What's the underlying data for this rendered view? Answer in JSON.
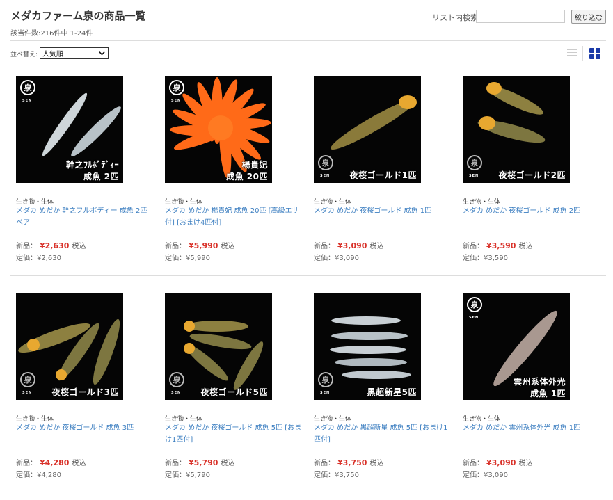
{
  "header": {
    "title": "メダカファーム泉の商品一覧",
    "result_count": "該当件数:216件中 1-24件",
    "search_label": "リスト内検索:",
    "search_value": "",
    "filter_button": "絞り込む"
  },
  "sort": {
    "label": "並べ替え:",
    "selected": "人気順"
  },
  "view_toggle": {
    "active": "grid"
  },
  "brand": {
    "logo_char": "泉",
    "logo_text": "SEN"
  },
  "labels": {
    "new_price": "新品：",
    "tax": "税込",
    "list_price": "定価："
  },
  "colors": {
    "link": "#3d7fc1",
    "price": "#d9322a",
    "grid_icon": "#1a3aa8"
  },
  "products": [
    {
      "category": "生き物・生体",
      "name": "メダカ めだか 幹之フルボディー 成魚 2匹ペア",
      "price": "¥2,630",
      "list_price": "¥2,630",
      "caption": [
        "幹之ﾌﾙﾎﾞﾃﾞｨｰ",
        "成魚 2匹"
      ]
    },
    {
      "category": "生き物・生体",
      "name": "メダカ めだか 楊貴妃 成魚 20匹 [高級エサ付] [おまけ4匹付]",
      "price": "¥5,990",
      "list_price": "¥5,990",
      "caption": [
        "楊貴妃",
        "成魚 20匹"
      ]
    },
    {
      "category": "生き物・生体",
      "name": "メダカ めだか 夜桜ゴールド 成魚 1匹",
      "price": "¥3,090",
      "list_price": "¥3,090",
      "caption": [
        "夜桜ゴールド1匹"
      ]
    },
    {
      "category": "生き物・生体",
      "name": "メダカ めだか 夜桜ゴールド 成魚 2匹",
      "price": "¥3,590",
      "list_price": "¥3,590",
      "caption": [
        "夜桜ゴールド2匹"
      ]
    },
    {
      "category": "生き物・生体",
      "name": "メダカ めだか 夜桜ゴールド 成魚 3匹",
      "price": "¥4,280",
      "list_price": "¥4,280",
      "caption": [
        "夜桜ゴールド3匹"
      ]
    },
    {
      "category": "生き物・生体",
      "name": "メダカ めだか 夜桜ゴールド 成魚 5匹 [おまけ1匹付]",
      "price": "¥5,790",
      "list_price": "¥5,790",
      "caption": [
        "夜桜ゴールド5匹"
      ]
    },
    {
      "category": "生き物・生体",
      "name": "メダカ めだか 黒超新星 成魚 5匹 [おまけ1匹付]",
      "price": "¥3,750",
      "list_price": "¥3,750",
      "caption": [
        "黒超新星5匹"
      ]
    },
    {
      "category": "生き物・生体",
      "name": "メダカ めだか 雲州系体外光 成魚 1匹",
      "price": "¥3,090",
      "list_price": "¥3,090",
      "caption": [
        "雲州系体外光",
        "成魚 1匹"
      ]
    }
  ]
}
